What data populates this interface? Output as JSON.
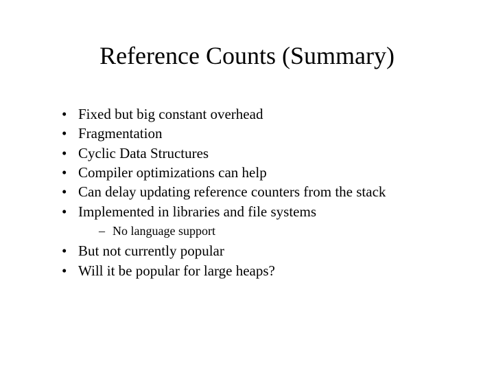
{
  "title": "Reference Counts (Summary)",
  "bullets": [
    "Fixed but big constant overhead",
    "Fragmentation",
    "Cyclic Data Structures",
    "Compiler optimizations can help",
    "Can delay updating reference counters from the stack",
    "Implemented in libraries and file systems"
  ],
  "sub_bullets": [
    "No language support"
  ],
  "tail_bullets": [
    "But not currently popular",
    "Will it be popular for large heaps?"
  ]
}
